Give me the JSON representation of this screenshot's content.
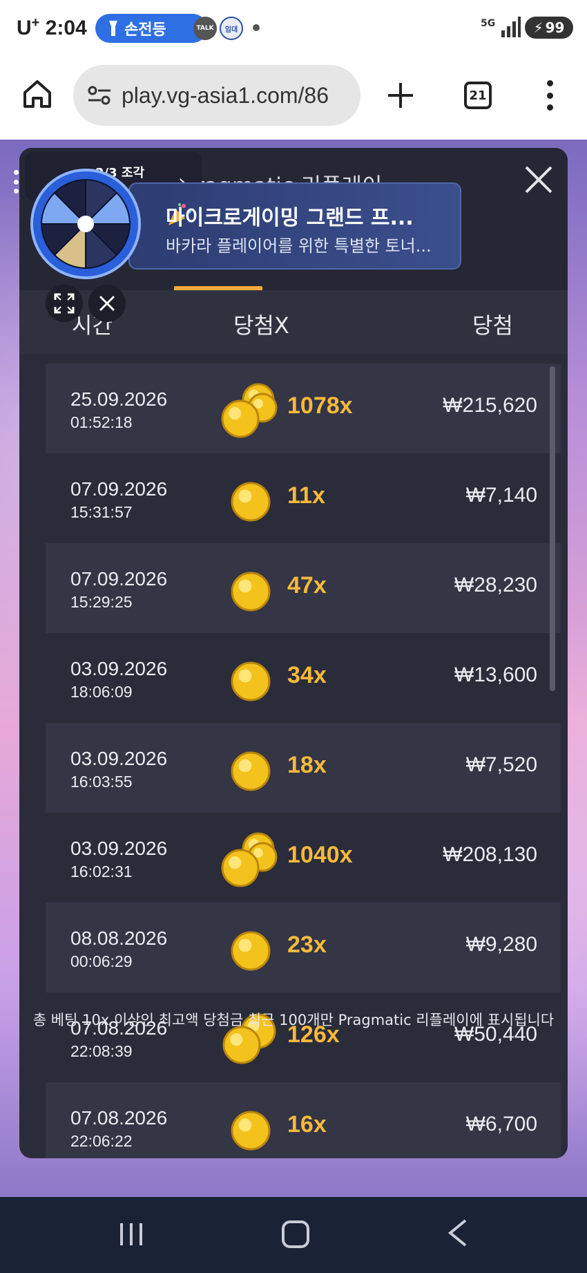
{
  "status_bar": {
    "carrier": "U",
    "carrier_sup": "+",
    "time": "2:04",
    "flashlight_label": "손전등",
    "talk_label": "TALK",
    "notif_label": "임대",
    "network": "5G",
    "battery": "99"
  },
  "browser": {
    "url": "play.vg-asia1.com/86",
    "tab_count": "21"
  },
  "overlay": {
    "piece_label": "2/3 조각",
    "arrow": "›"
  },
  "promo": {
    "title": "마이크로게이밍 그랜드 프...",
    "subtitle": "바카라 플레이어를 위한 특별한 토너..."
  },
  "modal": {
    "title": "Pragmatic 리플레이",
    "columns": {
      "time": "시간",
      "multiplier": "당첨X",
      "win": "당첨"
    },
    "rows": [
      {
        "date": "25.09.2026",
        "time": "01:52:18",
        "multiplier": "1078x",
        "win": "₩215,620",
        "coins": 3
      },
      {
        "date": "07.09.2026",
        "time": "15:31:57",
        "multiplier": "11x",
        "win": "₩7,140",
        "coins": 1
      },
      {
        "date": "07.09.2026",
        "time": "15:29:25",
        "multiplier": "47x",
        "win": "₩28,230",
        "coins": 1
      },
      {
        "date": "03.09.2026",
        "time": "18:06:09",
        "multiplier": "34x",
        "win": "₩13,600",
        "coins": 1
      },
      {
        "date": "03.09.2026",
        "time": "16:03:55",
        "multiplier": "18x",
        "win": "₩7,520",
        "coins": 1
      },
      {
        "date": "03.09.2026",
        "time": "16:02:31",
        "multiplier": "1040x",
        "win": "₩208,130",
        "coins": 3
      },
      {
        "date": "08.08.2026",
        "time": "00:06:29",
        "multiplier": "23x",
        "win": "₩9,280",
        "coins": 1
      },
      {
        "date": "07.08.2026",
        "time": "22:08:39",
        "multiplier": "126x",
        "win": "₩50,440",
        "coins": 2
      },
      {
        "date": "07.08.2026",
        "time": "22:06:22",
        "multiplier": "16x",
        "win": "₩6,700",
        "coins": 1
      }
    ],
    "footer_note": "총 베팅 10x 이상인 최고액 당첨금 최근 100개만 Pragmatic 리플레이에 표시됩니다"
  },
  "colors": {
    "modal_bg": "#2b2c3a",
    "row_alt_bg": "#343545",
    "accent": "#f2a93b",
    "multiplier": "#f6b93b"
  }
}
